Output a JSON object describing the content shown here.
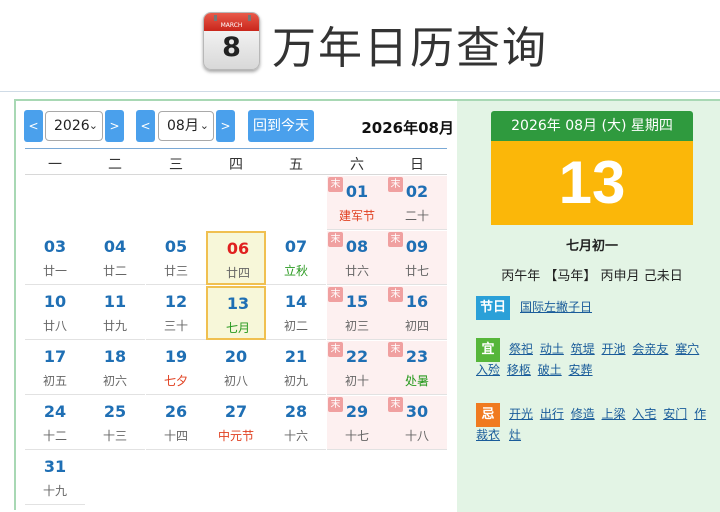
{
  "app": {
    "title": "万年日历查询",
    "icon_month": "MARCH",
    "icon_day": "8"
  },
  "toolbar": {
    "prev": "<",
    "next": ">",
    "year_value": "2026",
    "month_value": "08月",
    "today_label": "回到今天",
    "current_month": "2026年08月"
  },
  "weekdays": [
    "一",
    "二",
    "三",
    "四",
    "五",
    "六",
    "日"
  ],
  "weeks": [
    [
      null,
      null,
      null,
      null,
      null,
      {
        "day": "01",
        "lunar": "建军节",
        "badge": "末",
        "style": "red"
      },
      {
        "day": "02",
        "lunar": "二十",
        "badge": "末"
      }
    ],
    [
      {
        "day": "03",
        "lunar": "廿一"
      },
      {
        "day": "04",
        "lunar": "廿二"
      },
      {
        "day": "05",
        "lunar": "廿三"
      },
      {
        "day": "06",
        "lunar": "廿四",
        "day_style": "red"
      },
      {
        "day": "07",
        "lunar": "立秋",
        "style": "green"
      },
      {
        "day": "08",
        "lunar": "廿六",
        "badge": "末"
      },
      {
        "day": "09",
        "lunar": "廿七",
        "badge": "末"
      }
    ],
    [
      {
        "day": "10",
        "lunar": "廿八"
      },
      {
        "day": "11",
        "lunar": "廿九"
      },
      {
        "day": "12",
        "lunar": "三十"
      },
      {
        "day": "13",
        "lunar": "七月",
        "style": "green"
      },
      {
        "day": "14",
        "lunar": "初二"
      },
      {
        "day": "15",
        "lunar": "初三",
        "badge": "末"
      },
      {
        "day": "16",
        "lunar": "初四",
        "badge": "末"
      }
    ],
    [
      {
        "day": "17",
        "lunar": "初五"
      },
      {
        "day": "18",
        "lunar": "初六"
      },
      {
        "day": "19",
        "lunar": "七夕",
        "style": "red"
      },
      {
        "day": "20",
        "lunar": "初八"
      },
      {
        "day": "21",
        "lunar": "初九"
      },
      {
        "day": "22",
        "lunar": "初十",
        "badge": "末"
      },
      {
        "day": "23",
        "lunar": "处暑",
        "badge": "末",
        "style": "green"
      }
    ],
    [
      {
        "day": "24",
        "lunar": "十二"
      },
      {
        "day": "25",
        "lunar": "十三"
      },
      {
        "day": "26",
        "lunar": "十四"
      },
      {
        "day": "27",
        "lunar": "中元节",
        "style": "red"
      },
      {
        "day": "28",
        "lunar": "十六"
      },
      {
        "day": "29",
        "lunar": "十七",
        "badge": "末"
      },
      {
        "day": "30",
        "lunar": "十八",
        "badge": "末"
      }
    ],
    [
      {
        "day": "31",
        "lunar": "十九"
      },
      null,
      null,
      null,
      null,
      null,
      null
    ]
  ],
  "detail": {
    "header": "2026年 08月 (大) 星期四",
    "big_day": "13",
    "lunar_date": "七月初一",
    "ganzhi": "丙午年 【马年】 丙申月 己未日",
    "festival_tag": "节日",
    "festivals": [
      "国际左撇子日"
    ],
    "good_tag": "宜",
    "good": [
      "祭祀",
      "动土",
      "筑堤",
      "开池",
      "会亲友",
      "塞穴",
      "入殓",
      "移柩",
      "破土",
      "安葬"
    ],
    "bad_tag": "忌",
    "bad": [
      "开光",
      "出行",
      "修造",
      "上梁",
      "入宅",
      "安门",
      "作灶",
      "裁衣"
    ]
  }
}
